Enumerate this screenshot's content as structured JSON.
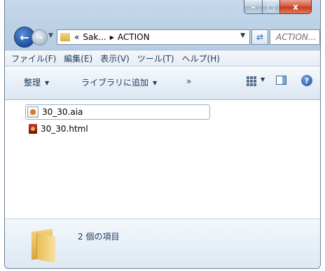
{
  "window": {
    "controls": {
      "minimize": "–",
      "maximize": "□",
      "close": "x"
    }
  },
  "address_bar": {
    "back_arrow": "←",
    "forward_arrow": "→",
    "overflow": "«",
    "crumbs": [
      "Sak...",
      "ACTION"
    ],
    "refresh_glyph": "⇄",
    "search_placeholder": "ACTION..."
  },
  "menu": {
    "items": [
      "ファイル(F)",
      "編集(E)",
      "表示(V)",
      "ツール(T)",
      "ヘルプ(H)"
    ]
  },
  "toolbar": {
    "organize": "整理",
    "add_to_library": "ライブラリに追加",
    "more": "»",
    "help": "?"
  },
  "files": [
    {
      "name": "30_30.aia",
      "icon": "aia-file-icon",
      "selected": true
    },
    {
      "name": "30_30.html",
      "icon": "html-file-icon",
      "selected": false
    }
  ],
  "status": {
    "item_count": "2 個の項目"
  },
  "colors": {
    "accent": "#1e395b",
    "selection_border": "#8fb1d8",
    "close_button": "#c23a1e"
  }
}
